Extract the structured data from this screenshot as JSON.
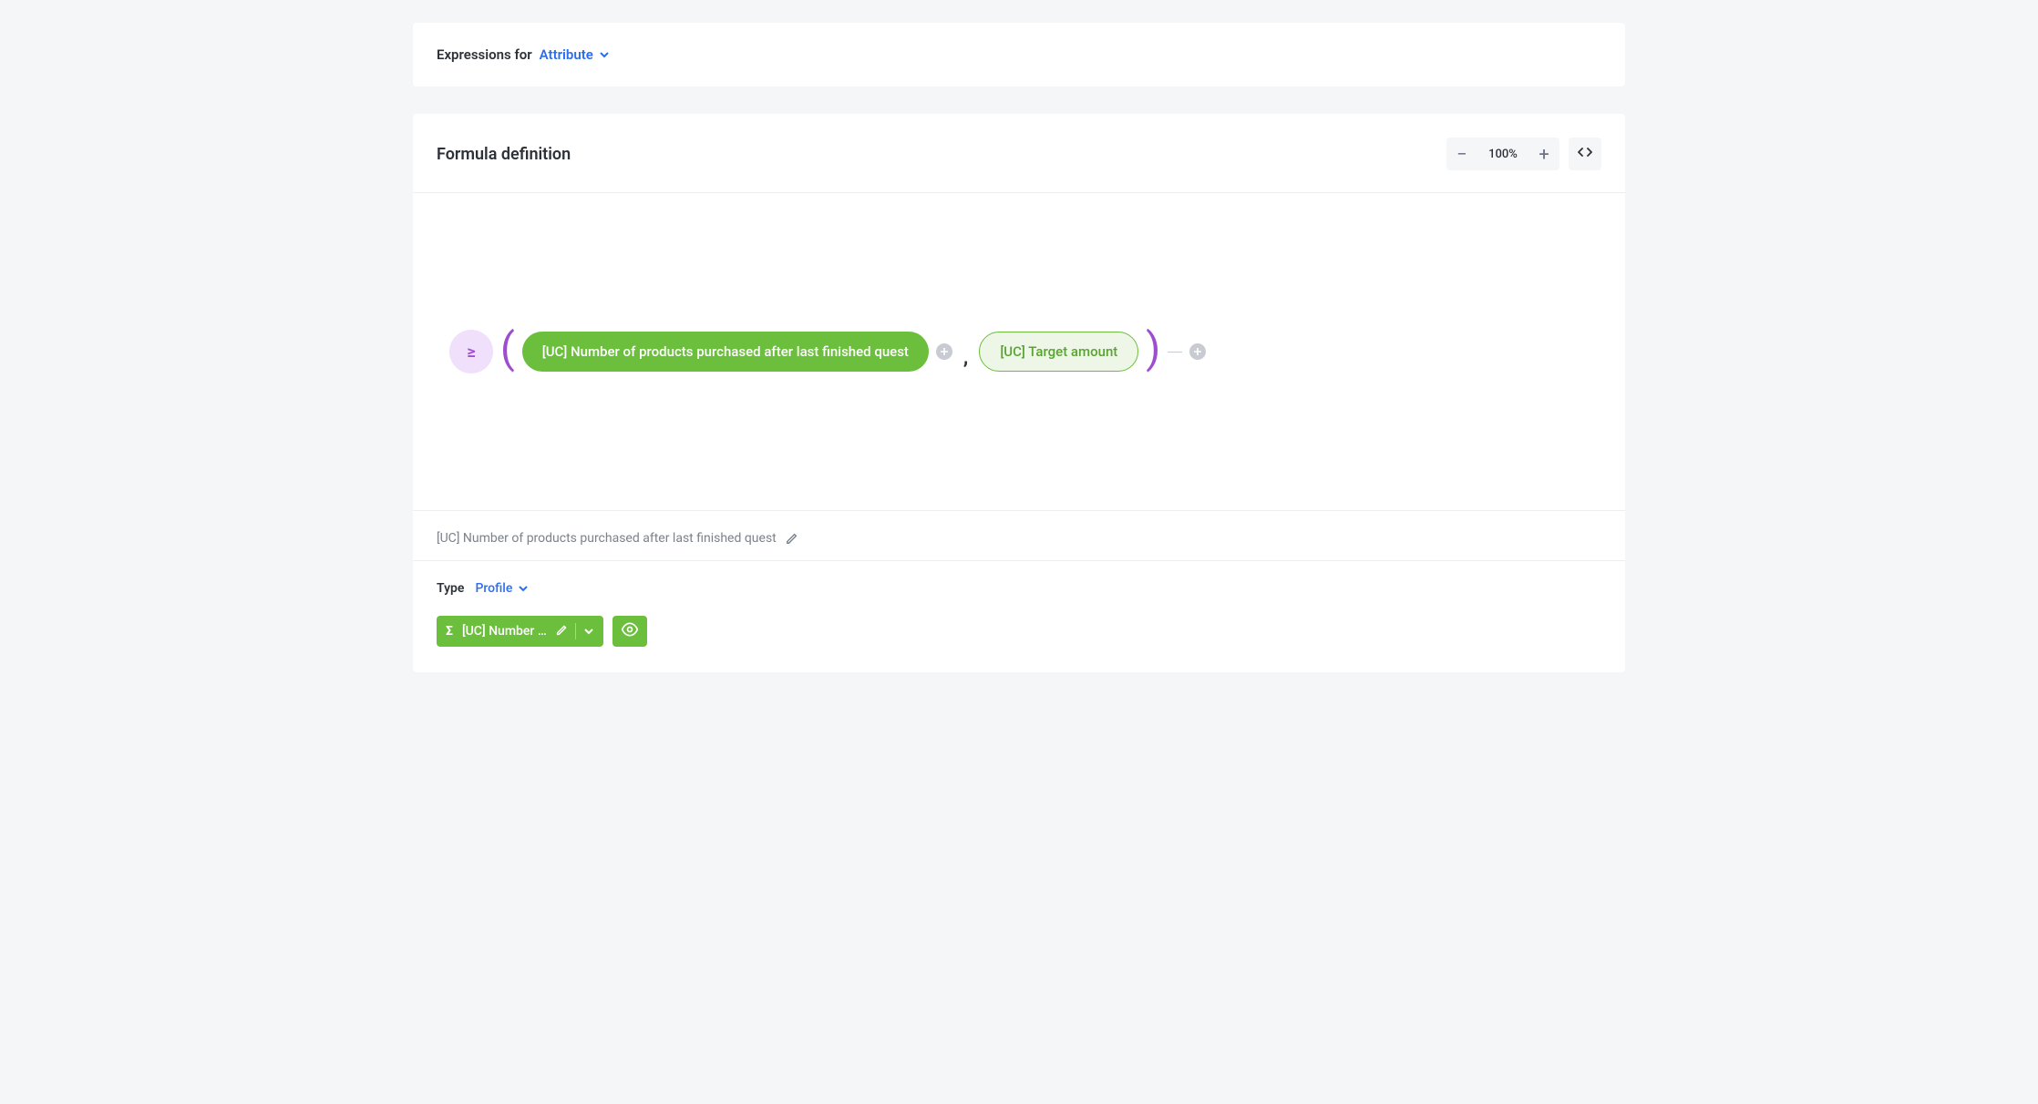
{
  "header": {
    "label": "Expressions for",
    "attribute": "Attribute"
  },
  "formula": {
    "title": "Formula definition",
    "zoom": "100%",
    "operator": "≥",
    "arg1": "[UC] Number of products purchased after last finished quest",
    "arg2": "[UC] Target amount"
  },
  "detail": {
    "name": "[UC] Number of products purchased after last finished quest"
  },
  "type": {
    "label": "Type",
    "value": "Profile"
  },
  "chip": {
    "sigma": "Σ",
    "label": "[UC] Number …"
  }
}
